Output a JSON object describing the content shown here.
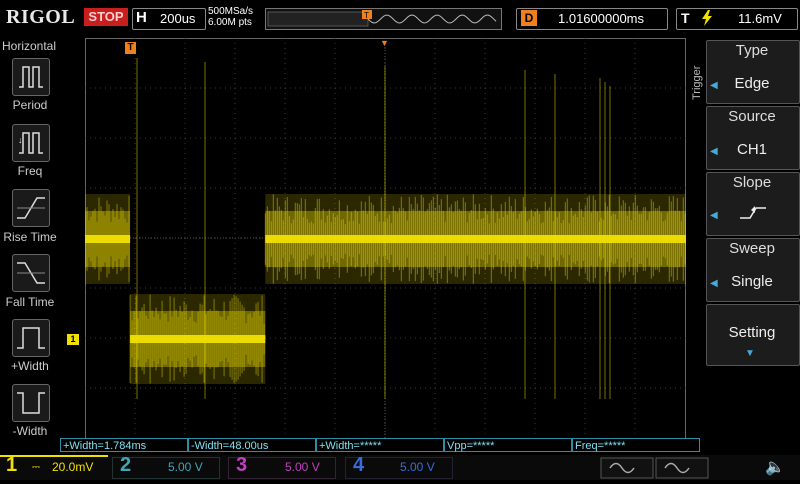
{
  "header": {
    "logo": "RIGOL",
    "run_state": "STOP",
    "timebase_key": "H",
    "timebase_value": "200us",
    "sample_rate": "500MSa/s",
    "memory_depth": "6.00M pts",
    "delay_key": "D",
    "delay_value": "1.01600000ms",
    "trigger_key": "T",
    "trigger_source_icon": "lightning-icon",
    "trigger_level": "11.6mV",
    "trigger_marker": "T"
  },
  "left_menu": {
    "title": "Horizontal",
    "items": [
      {
        "label": "Period"
      },
      {
        "label": "Freq"
      },
      {
        "label": "Rise Time"
      },
      {
        "label": "Fall Time"
      },
      {
        "label": "+Width"
      },
      {
        "label": "-Width"
      }
    ]
  },
  "channel_marker": "1",
  "trigger_panel": {
    "title": "Trigger",
    "type_label": "Type",
    "type_value": "Edge",
    "source_label": "Source",
    "source_value": "CH1",
    "slope_label": "Slope",
    "sweep_label": "Sweep",
    "sweep_value": "Single",
    "setting_label": "Setting"
  },
  "measurements": [
    "+Width=1.784ms",
    "-Width=48.00us",
    "+Width=*****",
    "Vpp=*****",
    "Freq=*****"
  ],
  "channels": [
    {
      "num": "1",
      "scale": "20.0mV",
      "color": "#f0e000"
    },
    {
      "num": "2",
      "scale": "5.00 V",
      "color": "#3fa6b8"
    },
    {
      "num": "3",
      "scale": "5.00 V",
      "color": "#c040c0"
    },
    {
      "num": "4",
      "scale": "5.00 V",
      "color": "#3a6cd8"
    }
  ],
  "waveform": {
    "color": "#f0e000",
    "levels_div": [
      {
        "from_div": 0.0,
        "to_div": 0.75,
        "level_div": 4.0
      },
      {
        "from_div": 0.75,
        "to_div": 3.0,
        "level_div": 2.0
      },
      {
        "from_div": 3.0,
        "to_div": 10.0,
        "level_div": 4.0
      }
    ]
  },
  "colors": {
    "accent": "#f07f1e",
    "ch1": "#f0e000",
    "measure": "#2b8fa8",
    "stop": "#c81e1e"
  }
}
